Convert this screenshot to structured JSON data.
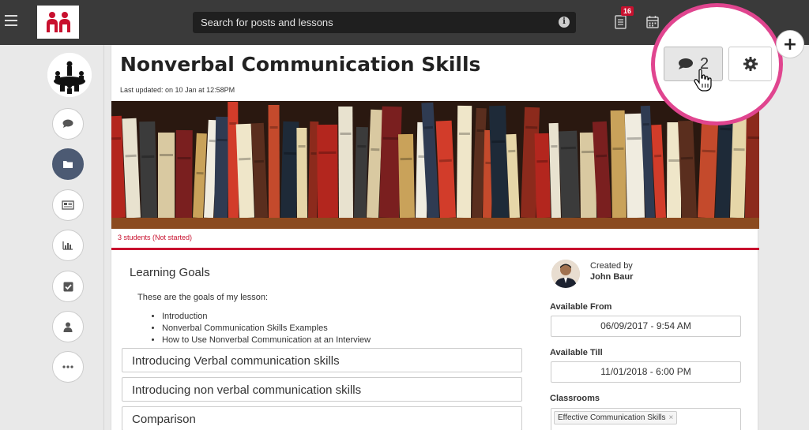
{
  "header": {
    "search_placeholder": "Search for posts and lessons",
    "notification_count": "16"
  },
  "lesson": {
    "title": "Nonverbal Communication Skills",
    "last_updated": "Last updated: on 10 Jan at 12:58PM",
    "status": "3 students (Not started)",
    "comment_count": "2"
  },
  "learning_goals": {
    "title": "Learning Goals",
    "intro": "These are the goals of my lesson:",
    "items": [
      "Introduction",
      "Nonverbal Communication Skills Examples",
      "How to Use Nonverbal Communication at an Interview"
    ]
  },
  "sections": [
    "Introducing Verbal communication skills",
    "Introducing non verbal communication skills",
    "Comparison"
  ],
  "sidebar": {
    "icons": [
      "comment-icon",
      "folder-icon",
      "newspaper-icon",
      "bar-chart-icon",
      "checkbox-icon",
      "user-icon",
      "more-icon"
    ]
  },
  "details": {
    "created_by_label": "Created by",
    "creator_name": "John Baur",
    "available_from_label": "Available From",
    "available_from": "06/09/2017 - 9:54 AM",
    "available_till_label": "Available Till",
    "available_till": "11/01/2018 - 6:00 PM",
    "classrooms_label": "Classrooms",
    "classroom_tag": "Effective Communication Skills",
    "tag_remove": "×"
  },
  "colors": {
    "accent_red": "#c8102e",
    "highlight_pink": "#e0458f",
    "topbar": "#3a3a3a",
    "active_nav": "#4c5a73"
  }
}
